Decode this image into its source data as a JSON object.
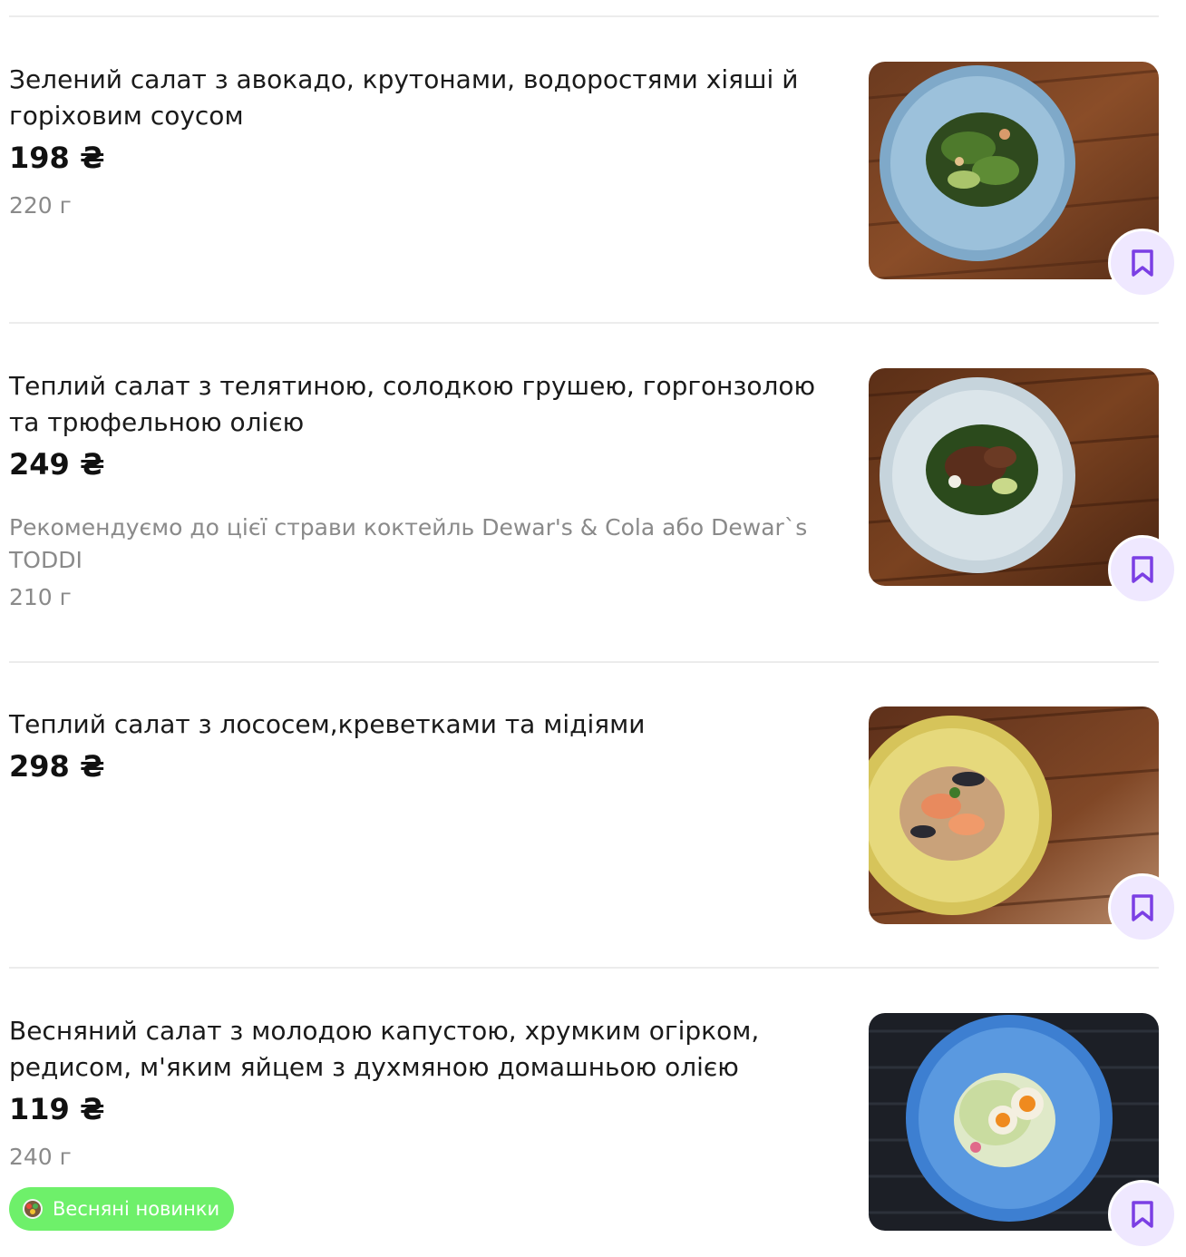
{
  "items": [
    {
      "name": "Зелений салат з авокадо, крутонами, водоростями хіяші й горіховим соусом",
      "price": "198 ₴",
      "weight": "220 г",
      "photo_icon": "salad-photo-green"
    },
    {
      "name": "Теплий салат з телятиною, солодкою грушею, горгонзолою та трюфельною олією",
      "price": "249 ₴",
      "description": "Рекомендуємо до цієї страви коктейль Dewar's & Cola або Dewar`s TODDI",
      "weight": "210 г",
      "photo_icon": "salad-photo-veal"
    },
    {
      "name": "Теплий салат з лососем,креветками та мідіями",
      "price": "298 ₴",
      "photo_icon": "salad-photo-salmon"
    },
    {
      "name": "Весняний салат з молодою капустою, хрумким огірком, редисом, м'яким яйцем з духмяною домашньою олією",
      "price": "119 ₴",
      "weight": "240 г",
      "badge": "Весняні новинки",
      "photo_icon": "salad-photo-spring"
    }
  ],
  "favorite_icon": "bookmark-icon",
  "colors": {
    "accent": "#7b3fe4",
    "fav_bg": "#efe8ff",
    "badge_bg": "#6ef06a",
    "muted_text": "#8a8a8a",
    "divider": "#ececec"
  }
}
